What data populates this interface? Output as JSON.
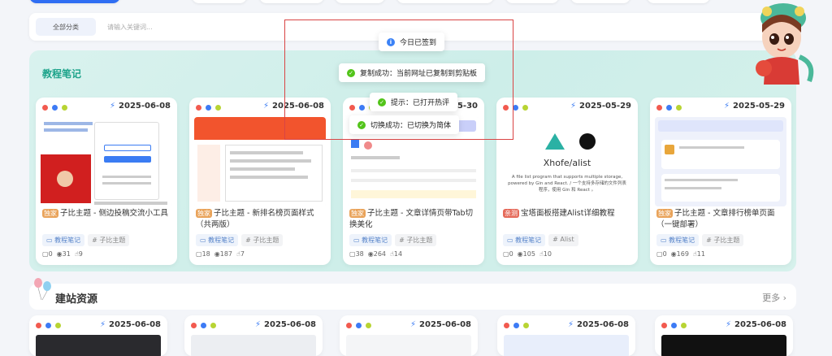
{
  "search": {
    "category": "全部分类",
    "placeholder": "请输入关键词..."
  },
  "tutorial": {
    "title": "教程笔记",
    "more_arrow": "›",
    "cards": [
      {
        "date": "2025-06-08",
        "badge": "独家",
        "title": "子比主题 - 侧边投稿交流小工具",
        "tags": [
          "教程笔记",
          "子比主题"
        ],
        "comments": "0",
        "views": "31",
        "likes": "9"
      },
      {
        "date": "2025-06-08",
        "badge": "独家",
        "title": "子比主题 - 新排名榜页面样式（共两版）",
        "tags": [
          "教程笔记",
          "子比主题"
        ],
        "comments": "18",
        "views": "187",
        "likes": "7"
      },
      {
        "date": "2025-05-30",
        "badge": "独家",
        "title": "子比主题 - 文章详情页带Tab切换美化",
        "tags": [
          "教程笔记",
          "子比主题"
        ],
        "comments": "38",
        "views": "264",
        "likes": "14"
      },
      {
        "date": "2025-05-29",
        "badge": "亲测",
        "title": "宝塔面板搭建Alist详细教程",
        "tags": [
          "教程笔记",
          "Alist"
        ],
        "comments": "0",
        "views": "105",
        "likes": "10",
        "thumb_text": "Xhofe/alist",
        "thumb_caption": "A file list program that supports multiple storage, powered by Gin and React. / 一个支持多存储的文件列表程序，使用 Gin 和 React 。"
      },
      {
        "date": "2025-05-29",
        "badge": "独家",
        "title": "子比主题 - 文章排行榜单页面（一键部署）",
        "tags": [
          "教程笔记",
          "子比主题"
        ],
        "comments": "0",
        "views": "169",
        "likes": "11"
      }
    ]
  },
  "resources": {
    "title": "建站资源",
    "more": "更多 ›",
    "cards": [
      {
        "date": "2025-06-08"
      },
      {
        "date": "2025-06-08"
      },
      {
        "date": "2025-06-08"
      },
      {
        "date": "2025-06-08"
      },
      {
        "date": "2025-06-08"
      }
    ]
  },
  "toasts": [
    {
      "type": "info",
      "text": "今日已签到"
    },
    {
      "type": "success",
      "text": "复制成功：当前网址已复制到剪贴板"
    },
    {
      "type": "success",
      "text": "提示：已打开热评"
    },
    {
      "type": "success",
      "text": "切换成功：已切换为简体"
    }
  ],
  "icons": {
    "date": "bolt-icon",
    "tag": "folder-icon",
    "hash": "hash-icon",
    "comments": "comment-icon",
    "views": "eye-icon",
    "likes": "thumb-icon"
  },
  "colors": {
    "accent": "#2f6ef3",
    "section_title": "#1ca38a",
    "badge": "#e9a35a",
    "toast_success": "#52c41a",
    "toast_info": "#3b82f6"
  }
}
